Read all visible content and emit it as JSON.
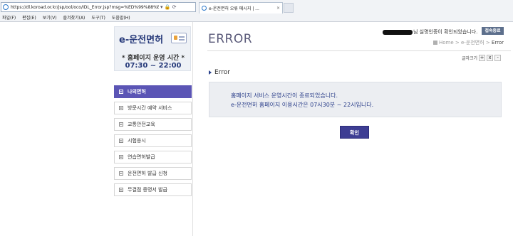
{
  "browser": {
    "url": "https://dl.koroad.or.kr/jsp/ool/oco/IDL_Error.jsp?msg=%ED%99%88%ED%8E%98",
    "tab_title": "e-운전면허 오류 메시지 | ...",
    "controls": "▾ 🔒 ⟳",
    "tab_close": "×",
    "menu": [
      "파일(F)",
      "편집(E)",
      "보기(V)",
      "즐겨찾기(A)",
      "도구(T)",
      "도움말(H)"
    ]
  },
  "sidebar": {
    "logo_title": "e-운전면허",
    "hours_label": "* 홈페이지 운영 시간 *",
    "hours_time": "07:30 ~ 22:00",
    "items": [
      {
        "label": "나의면허",
        "active": true
      },
      {
        "label": "방문시간 예약 서비스",
        "active": false
      },
      {
        "label": "교통안전교육",
        "active": false
      },
      {
        "label": "시험응시",
        "active": false
      },
      {
        "label": "연습면허발급",
        "active": false
      },
      {
        "label": "운전면허 발급 신청",
        "active": false
      },
      {
        "label": "무결점 증명서 발급",
        "active": false
      }
    ]
  },
  "header": {
    "page_title": "ERROR",
    "user_msg": "님 실명인증이 확인되었습니다.",
    "logout_label": "접속종료",
    "breadcrumb": {
      "home": "Home",
      "sep1": " > ",
      "section": "e-운전면허",
      "sep2": " > ",
      "current": "Error"
    },
    "font_size_label": "글자크기",
    "font_plus": "+",
    "font_reset": "x",
    "font_minus": "-"
  },
  "content": {
    "section_heading": "Error",
    "message_line1": "홈페이지 서비스 운영시간이 종료되었습니다.",
    "message_line2": "e-운전면허 홈페이지 이용시간은 07시30분 ~ 22시입니다.",
    "confirm_label": "확인"
  },
  "colors": {
    "accent": "#5b55b5",
    "button": "#3d3d93",
    "message_text": "#2b3f8a"
  }
}
